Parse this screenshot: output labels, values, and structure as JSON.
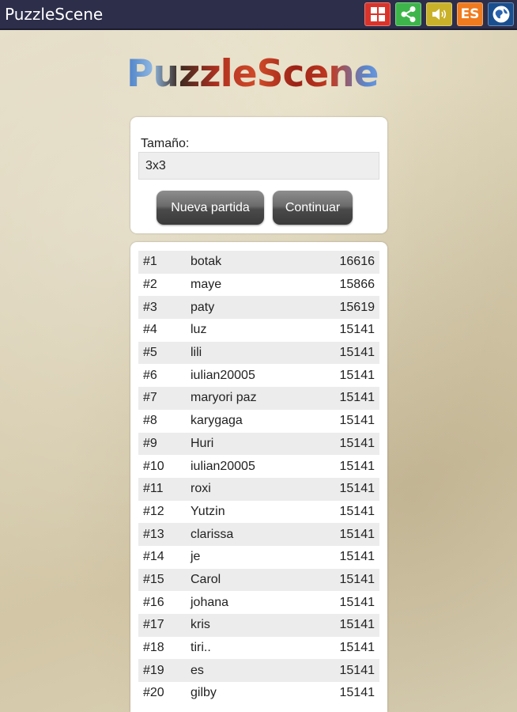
{
  "app": {
    "title": "PuzzleScene"
  },
  "actionbar": {
    "icons": [
      {
        "name": "grid-icon",
        "color": "#d9342b"
      },
      {
        "name": "share-icon",
        "color": "#3db54a"
      },
      {
        "name": "sound-icon",
        "color": "#c9b22a"
      },
      {
        "name": "language-icon",
        "label": "ES",
        "color": "#f07a1e"
      },
      {
        "name": "globe-icon",
        "color": "#1a4f8f"
      }
    ]
  },
  "logo": {
    "text": "PuzzleScene"
  },
  "size": {
    "label": "Tamaño:",
    "value": "3x3"
  },
  "buttons": {
    "new_game": "Nueva partida",
    "continue": "Continuar"
  },
  "scores": [
    {
      "rank": "#1",
      "name": "botak",
      "score": "16616"
    },
    {
      "rank": "#2",
      "name": "maye",
      "score": "15866"
    },
    {
      "rank": "#3",
      "name": "paty",
      "score": "15619"
    },
    {
      "rank": "#4",
      "name": "luz",
      "score": "15141"
    },
    {
      "rank": "#5",
      "name": "lili",
      "score": "15141"
    },
    {
      "rank": "#6",
      "name": "iulian20005",
      "score": "15141"
    },
    {
      "rank": "#7",
      "name": "maryori paz",
      "score": "15141"
    },
    {
      "rank": "#8",
      "name": "karygaga",
      "score": "15141"
    },
    {
      "rank": "#9",
      "name": "Huri",
      "score": "15141"
    },
    {
      "rank": "#10",
      "name": "iulian20005",
      "score": "15141"
    },
    {
      "rank": "#11",
      "name": "roxi",
      "score": "15141"
    },
    {
      "rank": "#12",
      "name": "Yutzin",
      "score": "15141"
    },
    {
      "rank": "#13",
      "name": "clarissa",
      "score": "15141"
    },
    {
      "rank": "#14",
      "name": "je",
      "score": "15141"
    },
    {
      "rank": "#15",
      "name": "Carol",
      "score": "15141"
    },
    {
      "rank": "#16",
      "name": "johana",
      "score": "15141"
    },
    {
      "rank": "#17",
      "name": "kris",
      "score": "15141"
    },
    {
      "rank": "#18",
      "name": "tiri..",
      "score": "15141"
    },
    {
      "rank": "#19",
      "name": "es",
      "score": "15141"
    },
    {
      "rank": "#20",
      "name": "gilby",
      "score": "15141"
    }
  ]
}
